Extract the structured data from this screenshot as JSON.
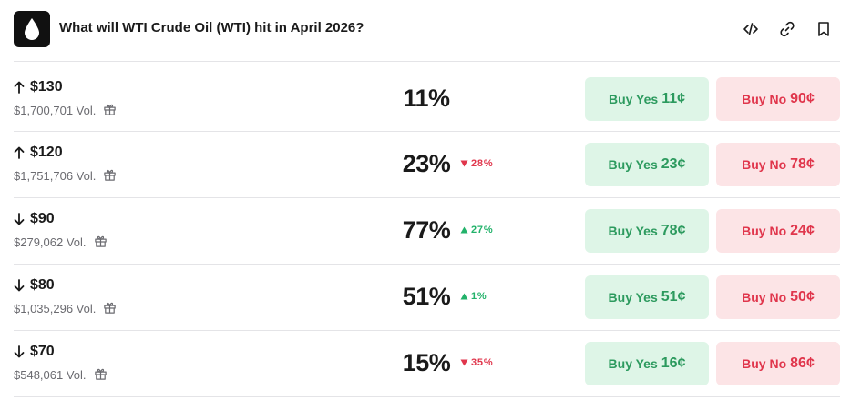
{
  "header": {
    "title": "What will WTI Crude Oil (WTI) hit in April 2026?",
    "icons": [
      "embed-icon",
      "link-icon",
      "bookmark-icon"
    ]
  },
  "colors": {
    "yes": "#2c9a5e",
    "no": "#e0364c",
    "up": "#22b26a",
    "down": "#e0364c"
  },
  "rows": [
    {
      "direction": "up",
      "label": "$130",
      "volume": "$1,700,701 Vol.",
      "chance": "11%",
      "change": "",
      "change_dir": "",
      "yes_label": "Buy Yes",
      "yes_price": "11¢",
      "no_label": "Buy No",
      "no_price": "90¢"
    },
    {
      "direction": "up",
      "label": "$120",
      "volume": "$1,751,706 Vol.",
      "chance": "23%",
      "change": "28%",
      "change_dir": "down",
      "yes_label": "Buy Yes",
      "yes_price": "23¢",
      "no_label": "Buy No",
      "no_price": "78¢"
    },
    {
      "direction": "down",
      "label": "$90",
      "volume": "$279,062 Vol.",
      "chance": "77%",
      "change": "27%",
      "change_dir": "up",
      "yes_label": "Buy Yes",
      "yes_price": "78¢",
      "no_label": "Buy No",
      "no_price": "24¢"
    },
    {
      "direction": "down",
      "label": "$80",
      "volume": "$1,035,296 Vol.",
      "chance": "51%",
      "change": "1%",
      "change_dir": "up",
      "yes_label": "Buy Yes",
      "yes_price": "51¢",
      "no_label": "Buy No",
      "no_price": "50¢"
    },
    {
      "direction": "down",
      "label": "$70",
      "volume": "$548,061 Vol.",
      "chance": "15%",
      "change": "35%",
      "change_dir": "down",
      "yes_label": "Buy Yes",
      "yes_price": "16¢",
      "no_label": "Buy No",
      "no_price": "86¢"
    }
  ]
}
